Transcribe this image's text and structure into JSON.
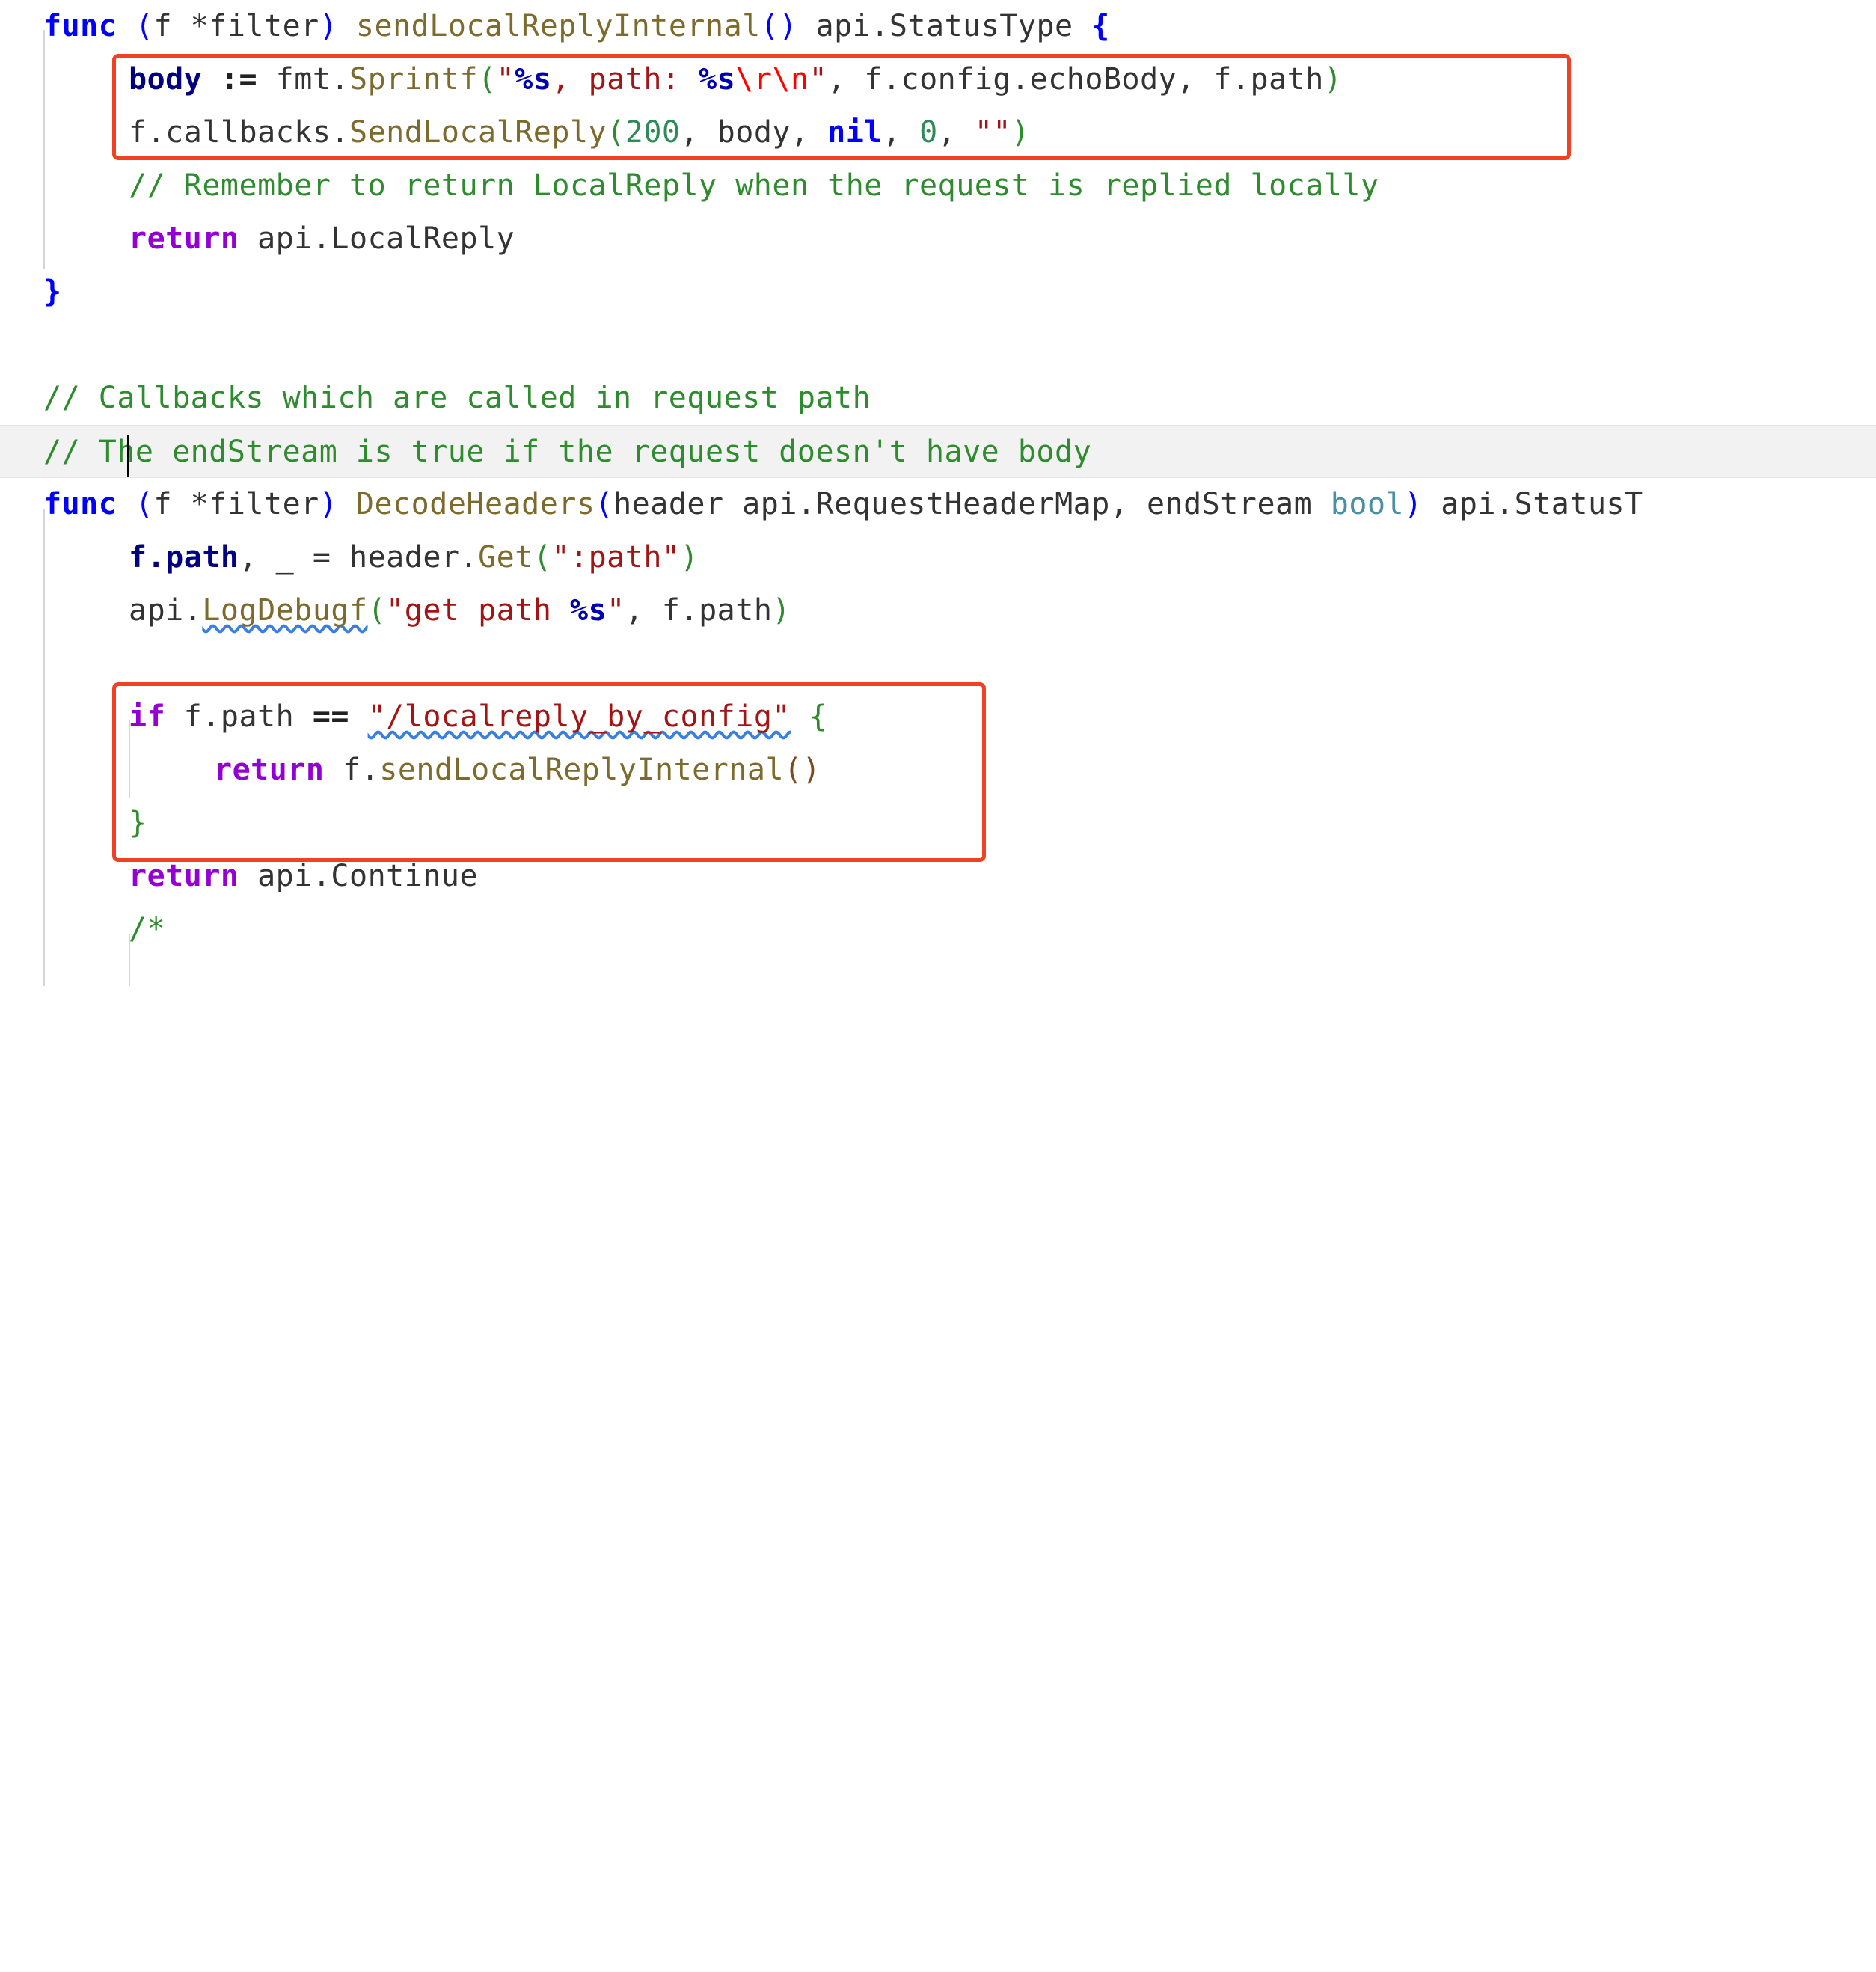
{
  "editor": {
    "language": "go",
    "background": "#ffffff",
    "current_line_index": 7,
    "font_size_px": 40,
    "line_height_px": 71
  },
  "colors": {
    "keyword": "#0000ff",
    "control_keyword": "#9400d3",
    "function": "#7d6b2e",
    "string": "#a31515",
    "string_verb": "#0000b0",
    "escape": "#ff0000",
    "number": "#2e8b57",
    "comment": "#2e8b2e",
    "field": "#000080",
    "type": "#4a90a4",
    "annotation_box": "#f04124",
    "current_line_highlight": "#f2f2f2",
    "indent_guide": "#d6d6d6",
    "squiggle": "#3a7fe0"
  },
  "lines": [
    {
      "index": 0,
      "text": "func (f *filter) sendLocalReplyInternal() api.StatusType {"
    },
    {
      "index": 1,
      "text": "    body := fmt.Sprintf(\"%s, path: %s\\r\\n\", f.config.echoBody, f.path)"
    },
    {
      "index": 2,
      "text": "    f.callbacks.SendLocalReply(200, body, nil, 0, \"\")"
    },
    {
      "index": 3,
      "text": "    // Remember to return LocalReply when the request is replied locally"
    },
    {
      "index": 4,
      "text": "    return api.LocalReply"
    },
    {
      "index": 5,
      "text": "}"
    },
    {
      "index": 6,
      "text": ""
    },
    {
      "index": 7,
      "text": "// Callbacks which are called in request path"
    },
    {
      "index": 8,
      "text": "// The endStream is true if the request doesn't have body"
    },
    {
      "index": 9,
      "text": "func (f *filter) DecodeHeaders(header api.RequestHeaderMap, endStream bool) api.StatusT"
    },
    {
      "index": 10,
      "text": "    f.path, _ = header.Get(\":path\")"
    },
    {
      "index": 11,
      "text": "    api.LogDebugf(\"get path %s\", f.path)"
    },
    {
      "index": 12,
      "text": ""
    },
    {
      "index": 13,
      "text": "    if f.path == \"/localreply_by_config\" {"
    },
    {
      "index": 14,
      "text": "        return f.sendLocalReplyInternal()"
    },
    {
      "index": 15,
      "text": "    }"
    },
    {
      "index": 16,
      "text": "    return api.Continue"
    },
    {
      "index": 17,
      "text": "    /*"
    }
  ],
  "tokens": {
    "l0": {
      "func": "func",
      "receiver_open": " (",
      "receiver": "f *filter",
      "receiver_close": ")",
      "name": " sendLocalReplyInternal",
      "parens": "()",
      "return_type": " api.StatusType ",
      "brace": "{"
    },
    "l1": {
      "var": "body",
      "assign": " := ",
      "pkg": "fmt.",
      "fn": "Sprintf",
      "open": "(",
      "quote1": "\"",
      "verb1": "%s",
      "mid": ", path: ",
      "verb2": "%s",
      "escape": "\\r\\n",
      "quote2": "\"",
      "args": ", f.config.echoBody, f.path",
      "close": ")"
    },
    "l2": {
      "recv": "f.callbacks.",
      "fn": "SendLocalReply",
      "open": "(",
      "num200": "200",
      "c1": ", body, ",
      "nil": "nil",
      "c2": ", ",
      "num0": "0",
      "c3": ", ",
      "emptystr": "\"\"",
      "close": ")"
    },
    "l3": {
      "comment": "// Remember to return LocalReply when the request is replied locally"
    },
    "l4": {
      "kw": "return",
      "expr": " api.LocalReply"
    },
    "l5": {
      "brace": "}"
    },
    "l7": {
      "comment": "// Callbacks which are called in request path"
    },
    "l8": {
      "comment_a": "// T",
      "comment_b": "he endStream is true if the request doesn't have body"
    },
    "l9": {
      "func": "func",
      "receiver_open": " (",
      "receiver": "f *filter",
      "receiver_close": ")",
      "name": " DecodeHeaders",
      "open": "(",
      "params_a": "header api.RequestHeaderMap, endStream ",
      "bool": "bool",
      "close": ")",
      "return_type": " api.StatusT"
    },
    "l10": {
      "field": "f.path",
      "mid": ", _ = header.",
      "fn": "Get",
      "open": "(",
      "str": "\":path\"",
      "close": ")"
    },
    "l11": {
      "pkg": "api.",
      "fn": "LogDebugf",
      "open": "(",
      "str_a": "\"get path ",
      "verb": "%s",
      "str_b": "\"",
      "args": ", f.path",
      "close": ")"
    },
    "l13": {
      "kw": "if",
      "cond_a": " f.path ",
      "op": "==",
      "sp": " ",
      "str": "\"/localreply_by_config\"",
      "sp2": " ",
      "brace": "{"
    },
    "l14": {
      "kw": "return",
      "fn_recv": " f.",
      "fn": "sendLocalReplyInternal",
      "parens": "()"
    },
    "l15": {
      "brace": "}"
    },
    "l16": {
      "kw": "return",
      "expr": " api.Continue"
    },
    "l17": {
      "comment": "/*"
    }
  },
  "annotations": [
    {
      "name": "highlight-box-local-reply",
      "covers_lines": "body := fmt.Sprintf(...) / f.callbacks.SendLocalReply(...)",
      "color": "#f04124"
    },
    {
      "name": "highlight-box-if-localreply-by-config",
      "covers_lines": "if f.path == \"/localreply_by_config\" { ... }",
      "color": "#f04124"
    }
  ]
}
